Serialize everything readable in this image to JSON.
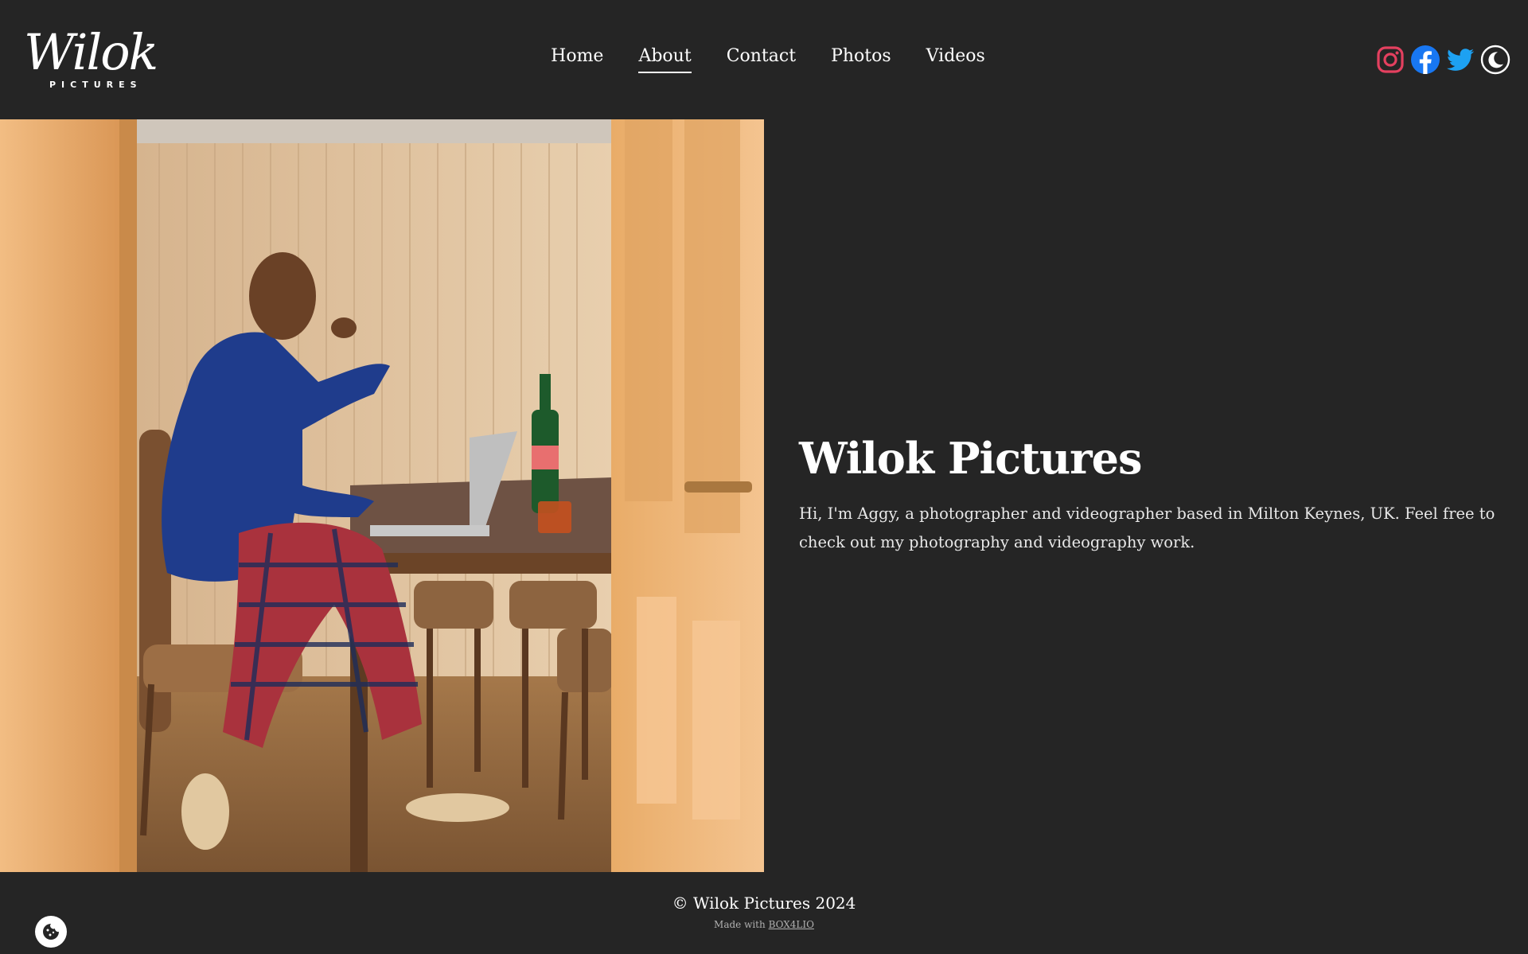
{
  "header": {
    "logo_script": "Wilok",
    "logo_sub": "PICTURES",
    "nav": [
      {
        "label": "Home"
      },
      {
        "label": "About",
        "active": true
      },
      {
        "label": "Contact"
      },
      {
        "label": "Photos"
      },
      {
        "label": "Videos"
      }
    ],
    "social_icons": [
      "instagram-icon",
      "facebook-icon",
      "twitter-icon",
      "dark-mode-moon-icon"
    ]
  },
  "hero": {
    "title": "Wilok Pictures",
    "description": "Hi, I'm Aggy, a photographer and videographer based in Milton Keynes, UK. Feel free to check out my photography and videography work."
  },
  "footer": {
    "copyright": "© Wilok Pictures 2024",
    "made_with_prefix": "Made with",
    "made_with_link": "BOX4LIO"
  },
  "colors": {
    "background": "#252525",
    "text": "#ffffff",
    "instagram": "#e4405f",
    "facebook": "#1877f2",
    "twitter": "#1da1f2"
  }
}
